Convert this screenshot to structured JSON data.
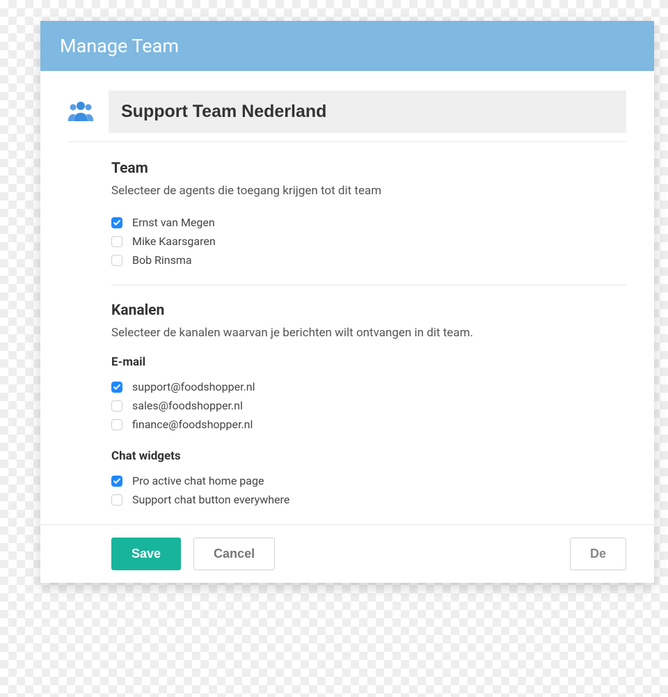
{
  "colors": {
    "header_bg": "#7fb8e0",
    "accent": "#1e88ff",
    "primary_btn": "#17b59b"
  },
  "header": {
    "title": "Manage Team"
  },
  "team_name": "Support Team Nederland",
  "sections": {
    "team": {
      "title": "Team",
      "desc": "Selecteer de agents die toegang krijgen tot dit team",
      "agents": [
        {
          "label": "Ernst van Megen",
          "checked": true
        },
        {
          "label": "Mike Kaarsgaren",
          "checked": false
        },
        {
          "label": "Bob Rinsma",
          "checked": false
        }
      ]
    },
    "channels": {
      "title": "Kanalen",
      "desc": "Selecteer de kanalen waarvan je berichten wilt ontvangen in dit team.",
      "email": {
        "heading": "E-mail",
        "items": [
          {
            "label": "support@foodshopper.nl",
            "checked": true
          },
          {
            "label": "sales@foodshopper.nl",
            "checked": false
          },
          {
            "label": "finance@foodshopper.nl",
            "checked": false
          }
        ]
      },
      "chat": {
        "heading": "Chat widgets",
        "items": [
          {
            "label": "Pro active chat home page",
            "checked": true
          },
          {
            "label": "Support chat button everywhere",
            "checked": false
          }
        ]
      }
    }
  },
  "footer": {
    "save": "Save",
    "cancel": "Cancel",
    "delete": "De"
  }
}
